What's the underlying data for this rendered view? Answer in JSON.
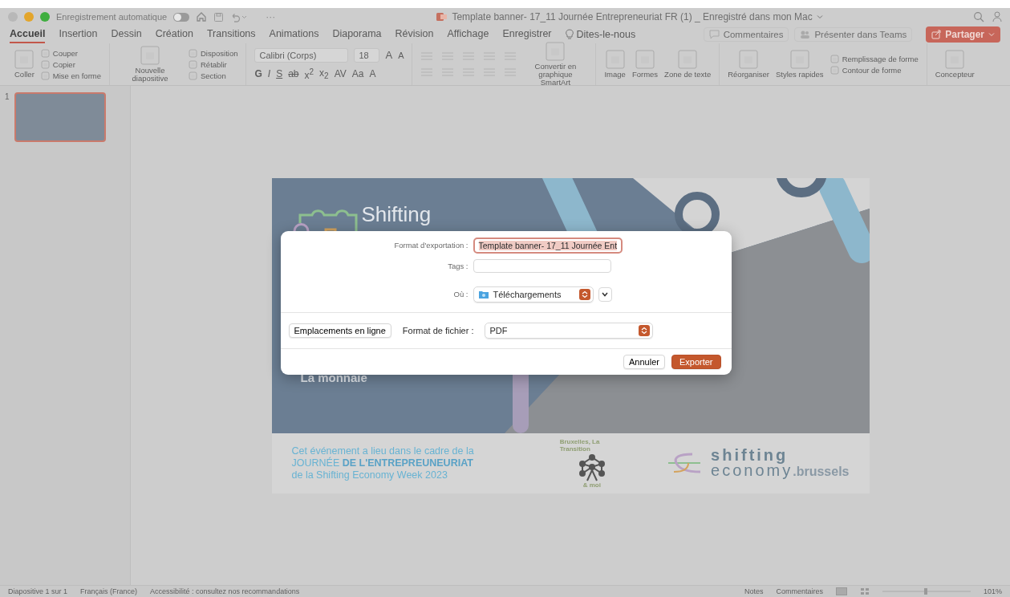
{
  "window": {
    "autosave_label": "Enregistrement automatique",
    "autosave_on": false,
    "more": "···",
    "title": "Template banner- 17_11 Journée Entrepreneuriat FR (1) _ Enregistré dans mon Mac"
  },
  "tabs": [
    {
      "label": "Accueil",
      "selected": true
    },
    {
      "label": "Insertion",
      "selected": false
    },
    {
      "label": "Dessin",
      "selected": false
    },
    {
      "label": "Création",
      "selected": false
    },
    {
      "label": "Transitions",
      "selected": false
    },
    {
      "label": "Animations",
      "selected": false
    },
    {
      "label": "Diaporama",
      "selected": false
    },
    {
      "label": "Révision",
      "selected": false
    },
    {
      "label": "Affichage",
      "selected": false
    },
    {
      "label": "Enregistrer",
      "selected": false
    }
  ],
  "tell_me": "Dites-le-nous",
  "header_buttons": {
    "comments": "Commentaires",
    "teams": "Présenter dans Teams",
    "share": "Partager"
  },
  "ribbon": [
    {
      "kind": "buttons",
      "columns": [
        [
          {
            "kind": "large",
            "label": "Coller"
          }
        ],
        [
          {
            "kind": "small",
            "label": "Couper"
          },
          {
            "kind": "small",
            "label": "Copier"
          },
          {
            "kind": "small",
            "label": "Mise en forme"
          }
        ]
      ]
    },
    {
      "kind": "buttons",
      "columns": [
        [
          {
            "kind": "large",
            "label": "Nouvelle diapositive"
          }
        ],
        [
          {
            "kind": "small",
            "label": "Disposition"
          },
          {
            "kind": "small",
            "label": "Rétablir"
          },
          {
            "kind": "small",
            "label": "Section"
          }
        ]
      ]
    },
    {
      "kind": "font",
      "font_name": "Calibri (Corps)",
      "font_size": "18",
      "size_buttons": [
        "A",
        "A"
      ],
      "format_buttons": [
        "G",
        "I",
        "S",
        "ab",
        "x$^{2}$",
        "x$_{2}$",
        "AV",
        "Aa",
        "A"
      ]
    },
    {
      "kind": "paragraph",
      "columns": [
        [
          {
            "kind": "large",
            "label": "Convertir en graphique SmartArt"
          }
        ]
      ]
    },
    {
      "kind": "buttons",
      "columns": [
        [
          {
            "kind": "large",
            "label": "Image"
          }
        ],
        [
          {
            "kind": "large",
            "label": "Formes"
          }
        ],
        [
          {
            "kind": "large",
            "label": "Zone de texte"
          }
        ]
      ]
    },
    {
      "kind": "buttons",
      "columns": [
        [
          {
            "kind": "large",
            "label": "Réorganiser"
          }
        ],
        [
          {
            "kind": "large",
            "label": "Styles rapides"
          }
        ],
        [
          {
            "kind": "small",
            "label": "Remplissage de forme"
          },
          {
            "kind": "small",
            "label": "Contour de forme"
          }
        ]
      ]
    },
    {
      "kind": "buttons",
      "columns": [
        [
          {
            "kind": "large",
            "label": "Concepteur"
          }
        ]
      ]
    }
  ],
  "thumbnails": [
    {
      "number": "1",
      "selected": true
    }
  ],
  "slide": {
    "title": "Shifting",
    "venue": "La monnaie",
    "footer_lines": [
      "Cet événement a lieu dans le cadre de la",
      "JOURNÉE **DE L'ENTREPREUNEURIAT**",
      "de la Shifting Economy Week 2023"
    ],
    "badge_top": "Bruxelles, La Transition",
    "badge_bottom": "& moi",
    "brand_top": "shifting",
    "brand_bottom": "economy",
    "brand_suffix": ".brussels"
  },
  "export_dialog": {
    "name_label": "Format d'exportation :",
    "name_value": "Template banner- 17_11 Journée Ent",
    "tags_label": "Tags :",
    "where_label": "Où :",
    "where_value": "Téléchargements",
    "online_button": "Emplacements en ligne",
    "format_label": "Format de fichier :",
    "format_value": "PDF",
    "cancel": "Annuler",
    "export": "Exporter"
  },
  "status_bar": {
    "left": [
      "Diapositive 1 sur 1",
      "Français (France)",
      "Accessibilité : consultez nos recommandations"
    ],
    "right": [
      "Notes",
      "Commentaires"
    ],
    "zoom": "101%"
  }
}
